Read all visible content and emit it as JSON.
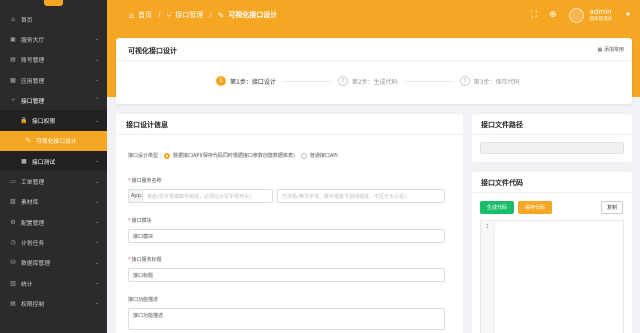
{
  "sidebar": {
    "items": [
      {
        "icon": "home-icon",
        "glyph": "⌂",
        "label": "首页",
        "chevron": ""
      },
      {
        "icon": "hall-icon",
        "glyph": "▣",
        "label": "服务大厅",
        "chevron": "⌄"
      },
      {
        "icon": "account-icon",
        "glyph": "▤",
        "label": "账号管理",
        "chevron": "⌄"
      },
      {
        "icon": "app-icon",
        "glyph": "▦",
        "label": "应用管理",
        "chevron": "⌄"
      },
      {
        "icon": "interface-icon",
        "glyph": "⑂",
        "label": "接口管理",
        "chevron": "⌃"
      },
      {
        "icon": "lock-icon",
        "glyph": "🔒",
        "label": "接口权限",
        "chevron": "⌄"
      },
      {
        "icon": "wand-icon",
        "glyph": "✎",
        "label": "可视化接口设计",
        "chevron": ""
      },
      {
        "icon": "test-icon",
        "glyph": "■",
        "label": "接口测试",
        "chevron": "⌄"
      },
      {
        "icon": "ticket-icon",
        "glyph": "▭",
        "label": "工单管理",
        "chevron": "⌄"
      },
      {
        "icon": "material-icon",
        "glyph": "▧",
        "label": "素材库",
        "chevron": "⌄"
      },
      {
        "icon": "config-icon",
        "glyph": "⚙",
        "label": "配置管理",
        "chevron": "⌄"
      },
      {
        "icon": "task-icon",
        "glyph": "◷",
        "label": "计划任务",
        "chevron": "⌄"
      },
      {
        "icon": "database-icon",
        "glyph": "⛁",
        "label": "数据库管理",
        "chevron": "⌄"
      },
      {
        "icon": "stats-icon",
        "glyph": "▥",
        "label": "统计",
        "chevron": "⌄"
      },
      {
        "icon": "permission-icon",
        "glyph": "▤",
        "label": "权限控制",
        "chevron": "⌄"
      }
    ]
  },
  "header": {
    "breadcrumbs": [
      "首页",
      "接口管理",
      "可视化接口设计"
    ],
    "username": "admin",
    "role": "超级管理员"
  },
  "topcard": {
    "title": "可视化接口设计",
    "favorite": "添加常用",
    "steps": [
      {
        "num": "1",
        "label": "第1步：接口设计"
      },
      {
        "num": "2",
        "label": "第2步：生成代码"
      },
      {
        "num": "3",
        "label": "第3步：保存代码"
      }
    ]
  },
  "design": {
    "title": "接口设计信息",
    "type_label": "接口设计类型",
    "type_opt1": "数据接口API(保存代码同时根据接口参数创建数据库表)",
    "type_opt2": "普通接口API",
    "service_label": "接口服务名称",
    "service_prefix": "App.",
    "service_ph1": "类名(仅字母或数字组成，必须以大写字母开头)",
    "service_ph2": "方法名(英文字母、数字或者下划线组成，不区分大小写)",
    "module_label": "接口模块",
    "module_ph": "接口模块",
    "svc_title_label": "接口服务标题",
    "svc_title_ph": "接口标题",
    "desc_label": "接口功能描述",
    "desc_ph": "接口功能描述"
  },
  "path": {
    "title": "接口文件路径"
  },
  "code": {
    "title": "接口文件代码",
    "gen": "生成代码",
    "save": "保存代码",
    "copy": "复制",
    "line": "1"
  },
  "colors": {
    "accent": "#f5a623",
    "green": "#19be6b",
    "sidebar": "#2b2b2b"
  }
}
